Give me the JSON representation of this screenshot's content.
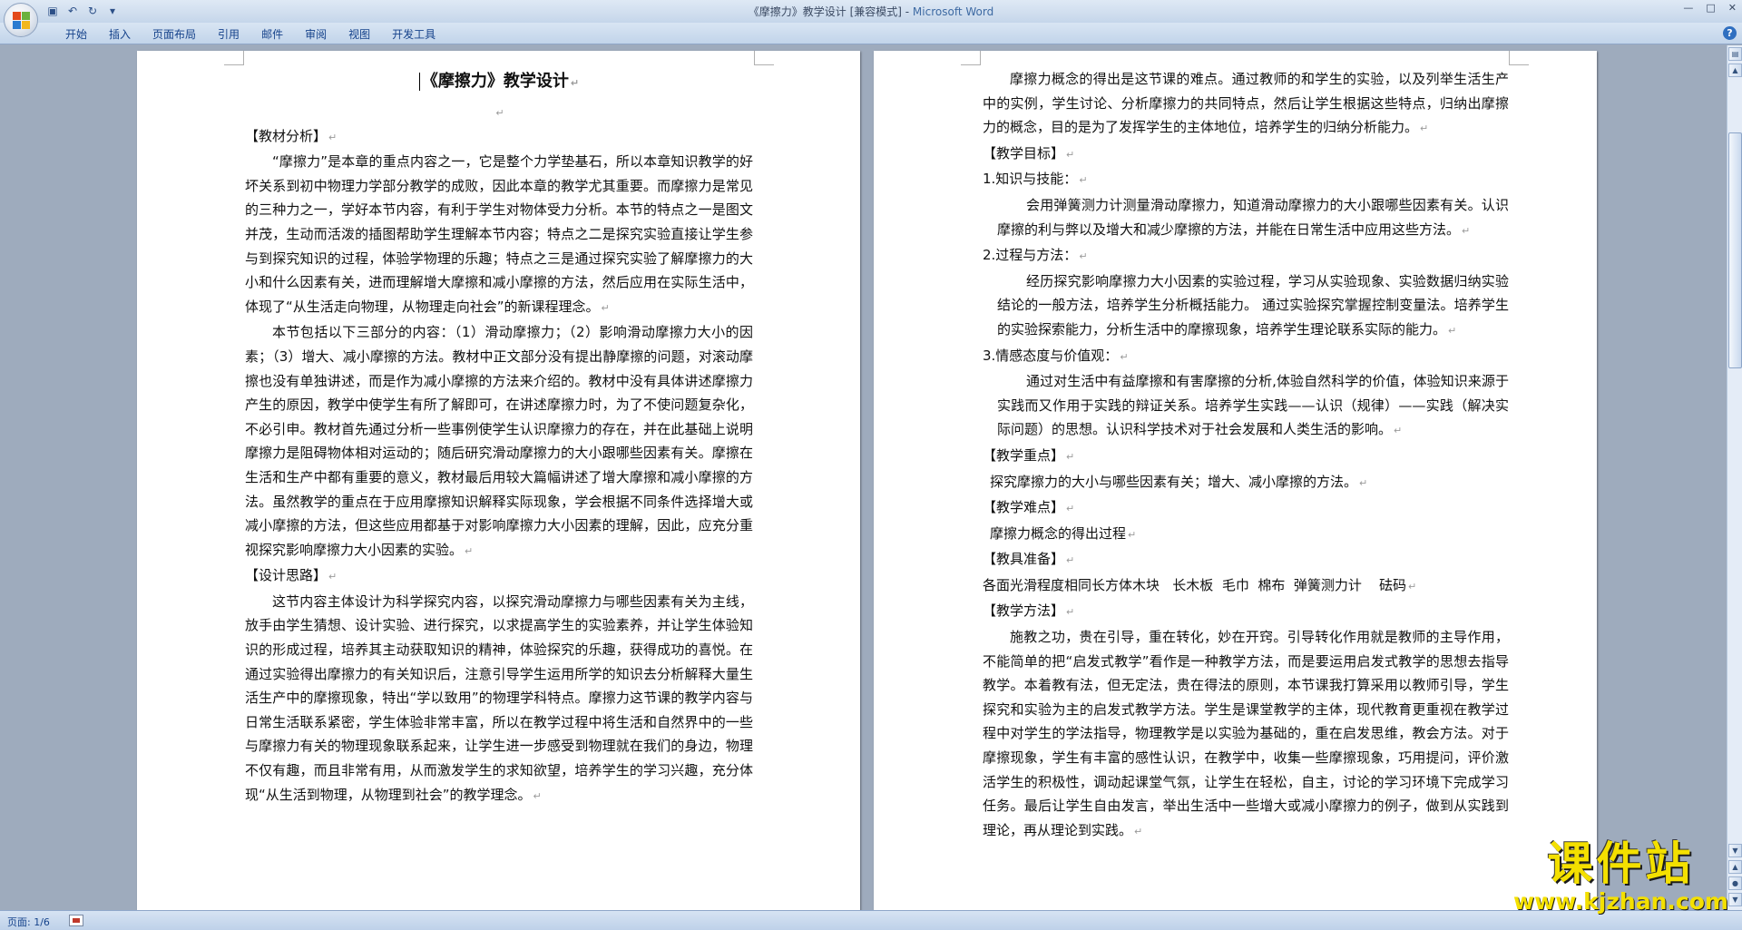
{
  "window": {
    "title_doc": "《摩擦力》教学设计 [兼容模式] - ",
    "title_app": "Microsoft Word"
  },
  "ribbon": {
    "tabs": [
      "开始",
      "插入",
      "页面布局",
      "引用",
      "邮件",
      "审阅",
      "视图",
      "开发工具"
    ]
  },
  "status": {
    "page": "页面: 1/6"
  },
  "watermark": {
    "title": "课件站",
    "url": "www.kjzhan.com"
  },
  "left_page": {
    "title": "《摩擦力》教学设计",
    "sec1_heading": "【教材分析】",
    "sec1_p1": "“摩擦力”是本章的重点内容之一，它是整个力学垫基石，所以本章知识教学的好坏关系到初中物理力学部分教学的成败，因此本章的教学尤其重要。而摩擦力是常见的三种力之一，学好本节内容，有利于学生对物体受力分析。本节的特点之一是图文并茂，生动而活泼的插图帮助学生理解本节内容；特点之二是探究实验直接让学生参与到探究知识的过程，体验学物理的乐趣；特点之三是通过探究实验了解摩擦力的大小和什么因素有关，进而理解增大摩擦和减小摩擦的方法，然后应用在实际生活中，体现了“从生活走向物理，从物理走向社会”的新课程理念。",
    "sec1_p2": "本节包括以下三部分的内容：（1）滑动摩擦力；（2）影响滑动摩擦力大小的因素；（3）增大、减小摩擦的方法。教材中正文部分没有提出静摩擦的问题，对滚动摩擦也没有单独讲述，而是作为减小摩擦的方法来介绍的。教材中没有具体讲述摩擦力产生的原因，教学中使学生有所了解即可，在讲述摩擦力时，为了不使问题复杂化，不必引申。教材首先通过分析一些事例使学生认识摩擦力的存在，并在此基础上说明摩擦力是阻碍物体相对运动的；随后研究滑动摩擦力的大小跟哪些因素有关。摩擦在生活和生产中都有重要的意义，教材最后用较大篇幅讲述了增大摩擦和减小摩擦的方法。虽然教学的重点在于应用摩擦知识解释实际现象，学会根据不同条件选择增大或减小摩擦的方法，但这些应用都基于对影响摩擦力大小因素的理解，因此，应充分重视探究影响摩擦力大小因素的实验。",
    "sec2_heading": "【设计思路】",
    "sec2_p1": "这节内容主体设计为科学探究内容，以探究滑动摩擦力与哪些因素有关为主线，放手由学生猜想、设计实验、进行探究，以求提高学生的实验素养，并让学生体验知识的形成过程，培养其主动获取知识的精神，体验探究的乐趣，获得成功的喜悦。在通过实验得出摩擦力的有关知识后，注意引导学生运用所学的知识去分析解释大量生活生产中的摩擦现象，特出“学以致用”的物理学科特点。摩擦力这节课的教学内容与日常生活联系紧密，学生体验非常丰富，所以在教学过程中将生活和自然界中的一些与摩擦力有关的物理现象联系起来，让学生进一步感受到物理就在我们的身边，物理不仅有趣，而且非常有用，从而激发学生的求知欲望，培养学生的学习兴趣，充分体现“从生活到物理，从物理到社会”的教学理念。"
  },
  "right_page": {
    "intro": "摩擦力概念的得出是这节课的难点。通过教师的和学生的实验，以及列举生活生产中的实例，学生讨论、分析摩擦力的共同特点，然后让学生根据这些特点，归纳出摩擦力的概念，目的是为了发挥学生的主体地位，培养学生的归纳分析能力。",
    "goals_heading": "【教学目标】",
    "goal1_label": "1.知识与技能：",
    "goal1_text": "会用弹簧测力计测量滑动摩擦力，知道滑动摩擦力的大小跟哪些因素有关。认识摩擦的利与弊以及增大和减少摩擦的方法，并能在日常生活中应用这些方法。",
    "goal2_label": "2.过程与方法：",
    "goal2_text": "经历探究影响摩擦力大小因素的实验过程，学习从实验现象、实验数据归纳实验结论的一般方法，培养学生分析概括能力。   通过实验探究掌握控制变量法。培养学生的实验探索能力，分析生活中的摩擦现象，培养学生理论联系实际的能力。",
    "goal3_label": "3.情感态度与价值观：",
    "goal3_text": "通过对生活中有益摩擦和有害摩擦的分析,体验自然科学的价值，体验知识来源于实践而又作用于实践的辩证关系。培养学生实践——认识（规律）——实践（解决实际问题）的思想。认识科学技术对于社会发展和人类生活的影响。",
    "key_heading": "【教学重点】",
    "key_text": "探究摩擦力的大小与哪些因素有关；增大、减小摩擦的方法。",
    "diff_heading": "【教学难点】",
    "diff_text": "摩擦力概念的得出过程",
    "tools_heading": "【教具准备】",
    "tools_text": "各面光滑程度相同长方体木块   长木板  毛巾  棉布  弹簧测力计    砝码",
    "method_heading": "【教学方法】",
    "method_text": "施教之功，贵在引导，重在转化，妙在开窍。引导转化作用就是教师的主导作用，不能简单的把“启发式教学”看作是一种教学方法，而是要运用启发式教学的思想去指导教学。本着教有法，但无定法，贵在得法的原则，本节课我打算采用以教师引导，学生探究和实验为主的启发式教学方法。学生是课堂教学的主体，现代教育更重视在教学过程中对学生的学法指导，物理教学是以实验为基础的，重在启发思维，教会方法。对于摩擦现象，学生有丰富的感性认识，在教学中，收集一些摩擦现象，巧用提问，评价激活学生的积极性，调动起课堂气氛，让学生在轻松，自主，讨论的学习环境下完成学习任务。最后让学生自由发言，举出生活中一些增大或减小摩擦力的例子，做到从实践到理论，再从理论到实践。"
  }
}
